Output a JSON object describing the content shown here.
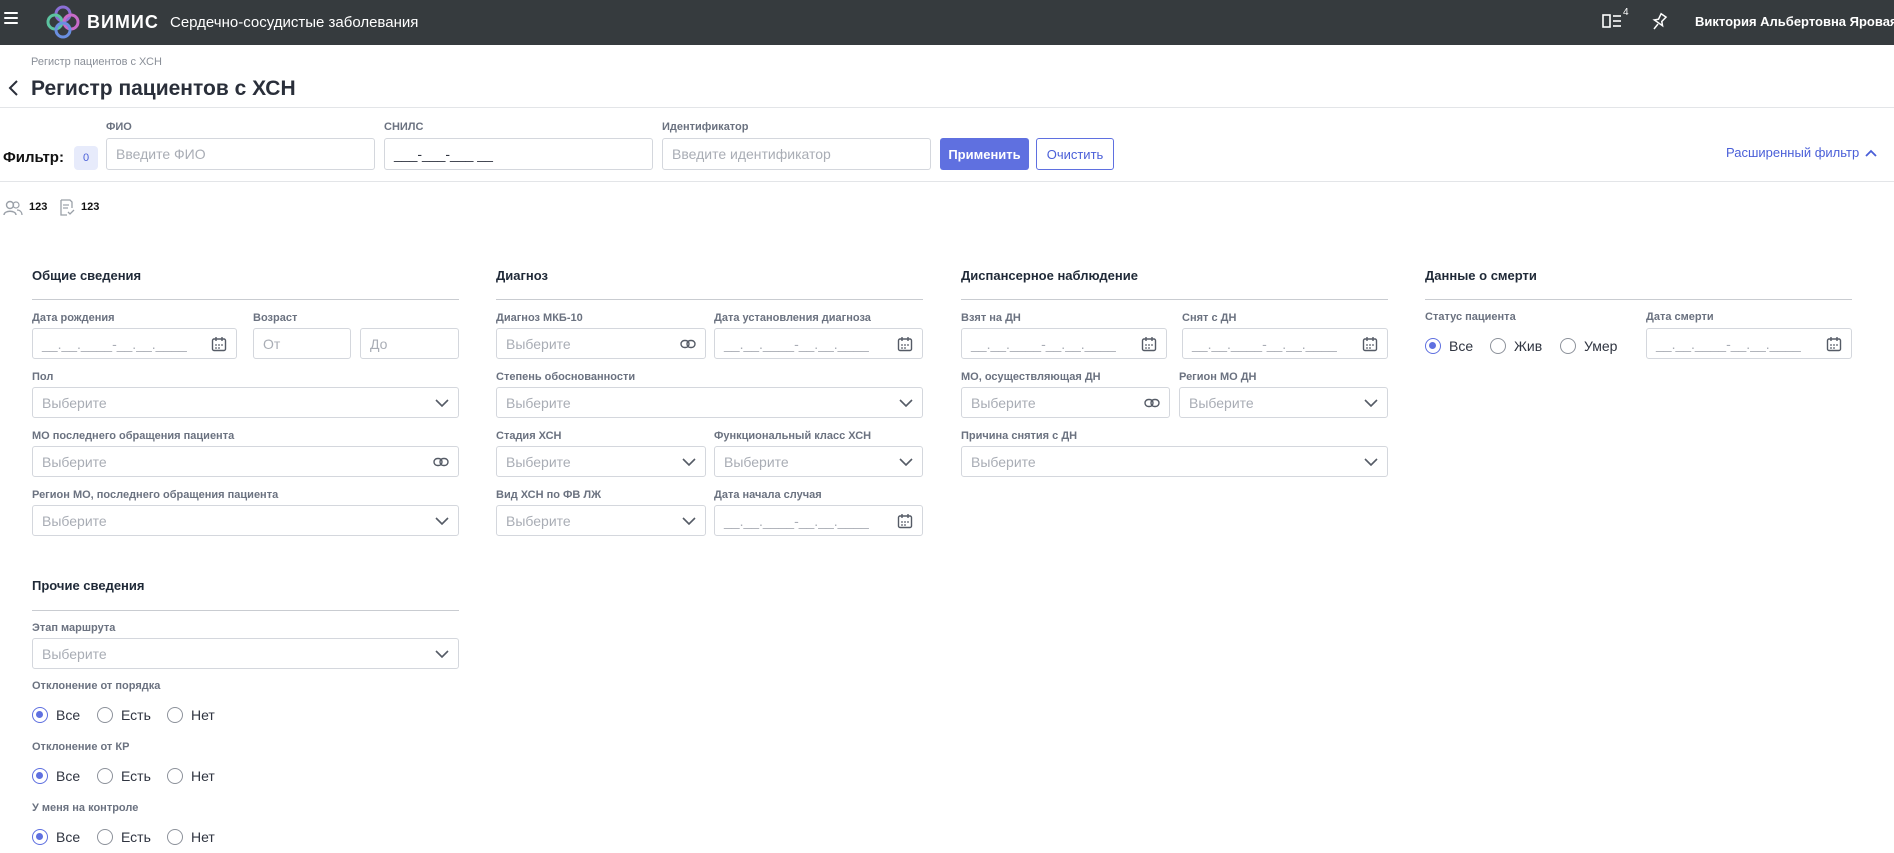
{
  "app": {
    "brand": "ВИМИС",
    "subtitle": "Сердечно-сосудистые заболевания",
    "notifications_count": "4",
    "user_name": "Виктория Альбертовна Яровая",
    "accent": "#5f70e0",
    "topbar_color": "#363b3e"
  },
  "header": {
    "breadcrumb": "Регистр пациентов с ХСН",
    "title": "Регистр пациентов с ХСН"
  },
  "filter": {
    "label": "Фильтр:",
    "active_count": "0",
    "fio_label": "ФИО",
    "fio_placeholder": "Введите ФИО",
    "snils_label": "СНИЛС",
    "snils_value": "___-___-___ __",
    "id_label": "Идентификатор",
    "id_placeholder": "Введите идентификатор",
    "apply": "Применить",
    "clear": "Очистить",
    "advanced": "Расширенный фильтр"
  },
  "stats": {
    "patients": "123",
    "records": "123"
  },
  "placeholders": {
    "select": "Выберите",
    "date": "__.__.____-__.__.____",
    "from": "От",
    "to": "До"
  },
  "general": {
    "title": "Общие сведения",
    "birth_date": "Дата рождения",
    "age": "Возраст",
    "sex": "Пол",
    "last_mo": "МО последнего обращения пациента",
    "last_mo_region": "Регион МО, последнего обращения пациента"
  },
  "diagnosis": {
    "title": "Диагноз",
    "mkb": "Диагноз МКБ-10",
    "diag_date": "Дата установления диагноза",
    "validity": "Степень обоснованности",
    "stage": "Стадия ХСН",
    "func_class": "Функциональный класс ХСН",
    "hf_type": "Вид ХСН по ФВ ЛЖ",
    "case_start": "Дата начала случая"
  },
  "dispensary": {
    "title": "Диспансерное наблюдение",
    "taken": "Взят на ДН",
    "removed": "Снят с ДН",
    "mo": "МО, осуществляющая ДН",
    "region": "Регион МО ДН",
    "reason": "Причина снятия с ДН"
  },
  "death": {
    "title": "Данные о смерти",
    "status": "Статус пациента",
    "date": "Дата смерти",
    "options": [
      "Все",
      "Жив",
      "Умер"
    ]
  },
  "other": {
    "title": "Прочие сведения",
    "route_stage": "Этап маршрута",
    "deviation_order": "Отклонение от порядка",
    "deviation_kr": "Отклонение от КР",
    "on_control": "У меня на контроле",
    "options": [
      "Все",
      "Есть",
      "Нет"
    ]
  }
}
